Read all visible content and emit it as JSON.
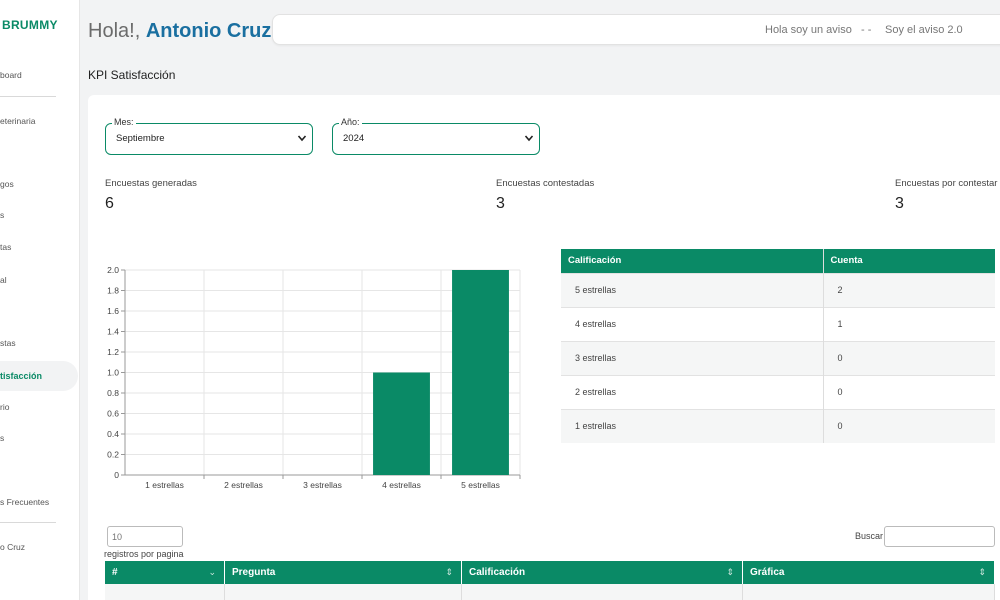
{
  "sidebar": {
    "brand": "BRUMMY",
    "items": [
      {
        "label": "board"
      },
      {
        "label": "eterinaria"
      },
      {
        "label": "gos"
      },
      {
        "label": "s"
      },
      {
        "label": "tas"
      },
      {
        "label": "al"
      },
      {
        "label": "stas"
      },
      {
        "label": "tisfacción"
      },
      {
        "label": "rio"
      },
      {
        "label": "s"
      },
      {
        "label": "s Frecuentes"
      },
      {
        "label": "o Cruz"
      }
    ]
  },
  "header": {
    "greeting": "Hola!,",
    "user_name": "Antonio Cruz",
    "notice_1": "Hola soy un aviso",
    "notice_sep": "- -",
    "notice_2": "Soy el aviso 2.0"
  },
  "page": {
    "title": "KPI Satisfacción"
  },
  "filters": {
    "month": {
      "label": "Mes:",
      "value": "Septiembre"
    },
    "year": {
      "label": "Año:",
      "value": "2024"
    }
  },
  "stats": {
    "generated": {
      "label": "Encuestas generadas",
      "value": "6"
    },
    "answered": {
      "label": "Encuestas contestadas",
      "value": "3"
    },
    "pending": {
      "label": "Encuestas por contestar",
      "value": "3"
    }
  },
  "colors": {
    "accent": "#0a8a66"
  },
  "chart_data": {
    "type": "bar",
    "categories": [
      "1 estrellas",
      "2 estrellas",
      "3 estrellas",
      "4 estrellas",
      "5 estrellas"
    ],
    "values": [
      0,
      0,
      0,
      1,
      2
    ],
    "ylim": [
      0,
      2.0
    ],
    "yticks": [
      "0",
      "0.2",
      "0.4",
      "0.6",
      "0.8",
      "1.0",
      "1.2",
      "1.4",
      "1.6",
      "1.8",
      "2.0"
    ],
    "grid": true
  },
  "ratings_table": {
    "headers": [
      "Calificación",
      "Cuenta"
    ],
    "rows": [
      [
        "5 estrellas",
        "2"
      ],
      [
        "4 estrellas",
        "1"
      ],
      [
        "3 estrellas",
        "0"
      ],
      [
        "2 estrellas",
        "0"
      ],
      [
        "1 estrellas",
        "0"
      ]
    ]
  },
  "data_table": {
    "per_page_placeholder": "10",
    "per_page_label": "registros por pagina",
    "search_label": "Buscar",
    "headers": [
      "#",
      "Pregunta",
      "Calificación",
      "Gráfica"
    ],
    "sort_icons": [
      "⌄",
      "⇕",
      "⇕",
      "⇕"
    ]
  }
}
